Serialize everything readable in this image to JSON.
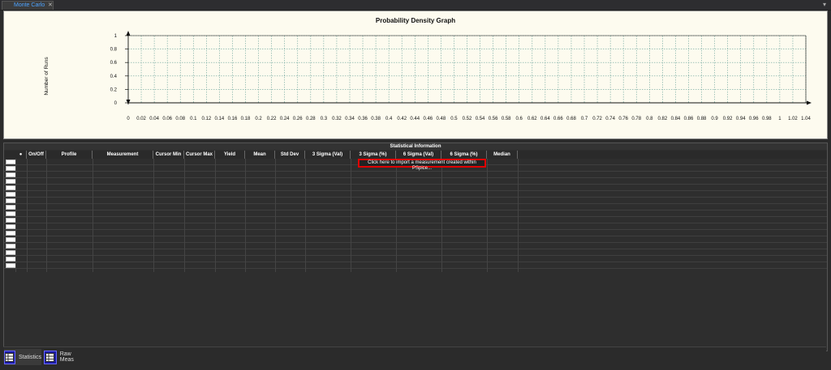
{
  "tab": {
    "title": "Monte Carlo",
    "close_glyph": "✕",
    "dropdown_glyph": "▾"
  },
  "chart_data": {
    "type": "bar",
    "title": "Probability Density Graph",
    "ylabel": "Number of Runs",
    "xlabel": "",
    "ylim": [
      0,
      1
    ],
    "y_ticks": [
      "0",
      "0.2",
      "0.4",
      "0.6",
      "0.8",
      "1"
    ],
    "x_ticks": [
      "0",
      "0.02",
      "0.04",
      "0.06",
      "0.08",
      "0.1",
      "0.12",
      "0.14",
      "0.16",
      "0.18",
      "0.2",
      "0.22",
      "0.24",
      "0.26",
      "0.28",
      "0.3",
      "0.32",
      "0.34",
      "0.36",
      "0.38",
      "0.4",
      "0.42",
      "0.44",
      "0.46",
      "0.48",
      "0.5",
      "0.52",
      "0.54",
      "0.56",
      "0.58",
      "0.6",
      "0.62",
      "0.64",
      "0.66",
      "0.68",
      "0.7",
      "0.72",
      "0.74",
      "0.76",
      "0.78",
      "0.8",
      "0.82",
      "0.84",
      "0.86",
      "0.88",
      "0.9",
      "0.92",
      "0.94",
      "0.96",
      "0.98",
      "1",
      "1.02",
      "1.04"
    ],
    "grid": true,
    "values": []
  },
  "stats": {
    "title": "Statistical Information",
    "columns": [
      "●",
      "On/Off",
      "Profile",
      "Measurement",
      "Cursor Min",
      "Cursor Max",
      "Yield",
      "Mean",
      "Std Dev",
      "3 Sigma (Val)",
      "3 Sigma (%)",
      "6 Sigma (Val)",
      "6 Sigma (%)",
      "Median"
    ],
    "import_prompt": "Click here to import a measurement created within PSpice...",
    "row_count": 17
  },
  "bottom_tabs": [
    {
      "label": "Statistics",
      "active": true
    },
    {
      "label": "Raw Meas",
      "active": false
    }
  ]
}
